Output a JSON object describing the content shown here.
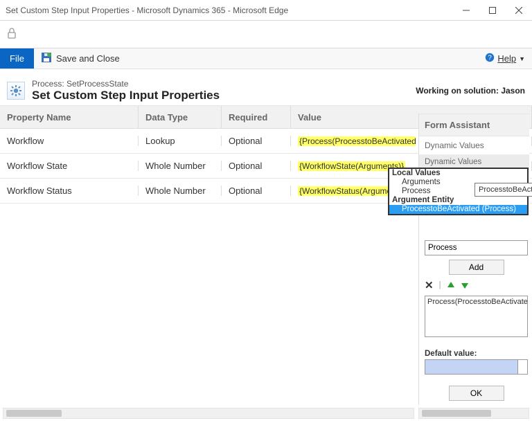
{
  "window": {
    "title": "Set Custom Step Input Properties - Microsoft Dynamics 365 - Microsoft Edge"
  },
  "ribbon": {
    "file_label": "File",
    "save_close": "Save and Close",
    "help_label": "Help"
  },
  "process": {
    "breadcrumb": "Process: SetProcessState",
    "title": "Set Custom Step Input Properties",
    "working_on": "Working on solution: Jason"
  },
  "grid": {
    "headers": {
      "name": "Property Name",
      "type": "Data Type",
      "req": "Required",
      "val": "Value"
    },
    "rows": [
      {
        "name": "Workflow",
        "type": "Lookup",
        "req": "Optional",
        "val": "{Process(ProcesstoBeActivated ("
      },
      {
        "name": "Workflow State",
        "type": "Whole Number",
        "req": "Optional",
        "val": "{WorkflowState(Arguments)}"
      },
      {
        "name": "Workflow Status",
        "type": "Whole Number",
        "req": "Optional",
        "val": "{WorkflowStatus(Arguments)}"
      }
    ]
  },
  "tree": {
    "local_values": "Local Values",
    "arguments": "Arguments",
    "process": "Process",
    "argument_entity": "Argument Entity",
    "selected_item": "ProcesstoBeActivated (Process)",
    "tooltip": "ProcesstoBeActivated (P"
  },
  "assistant": {
    "header": "Form Assistant",
    "dynamic_values": "Dynamic Values",
    "dyn_header": "Dynamic Values",
    "process_label": "Process",
    "add": "Add",
    "expr_value": "Process(ProcesstoBeActivated (Process))",
    "default_label": "Default value:",
    "ok": "OK"
  }
}
